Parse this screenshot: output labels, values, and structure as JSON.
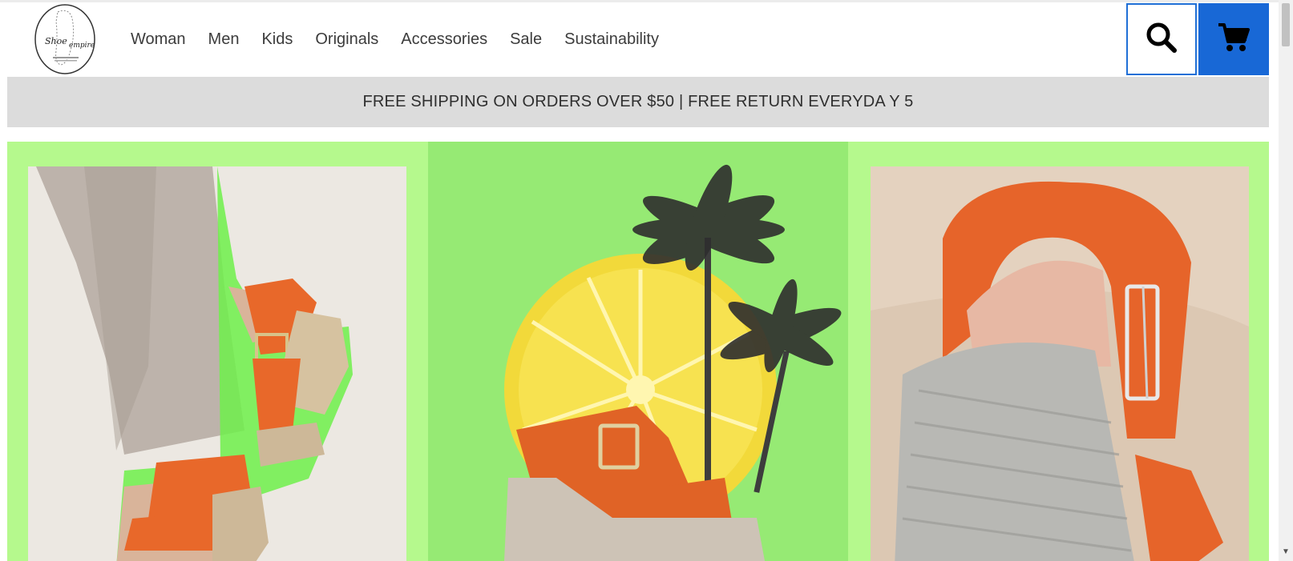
{
  "header": {
    "logo_text": "Shoe empire",
    "nav": [
      "Woman",
      "Men",
      "Kids",
      "Originals",
      "Accessories",
      "Sale",
      "Sustainability"
    ],
    "search_icon": "search-icon",
    "cart_icon": "cart-icon"
  },
  "announcement": {
    "text": "FREE SHIPPING ON ORDERS OVER $50 | FREE RETURN EVERYDA Y 5"
  },
  "hero": {
    "panels": [
      "left-sandal-photo",
      "lemon-palm-sandal-collage",
      "sandal-closeup-photo"
    ]
  },
  "colors": {
    "accent_blue": "#1868d6",
    "hero_green": "#b5f98d",
    "announce_bg": "#dcdcdc",
    "sandal_orange": "#e8682a"
  }
}
